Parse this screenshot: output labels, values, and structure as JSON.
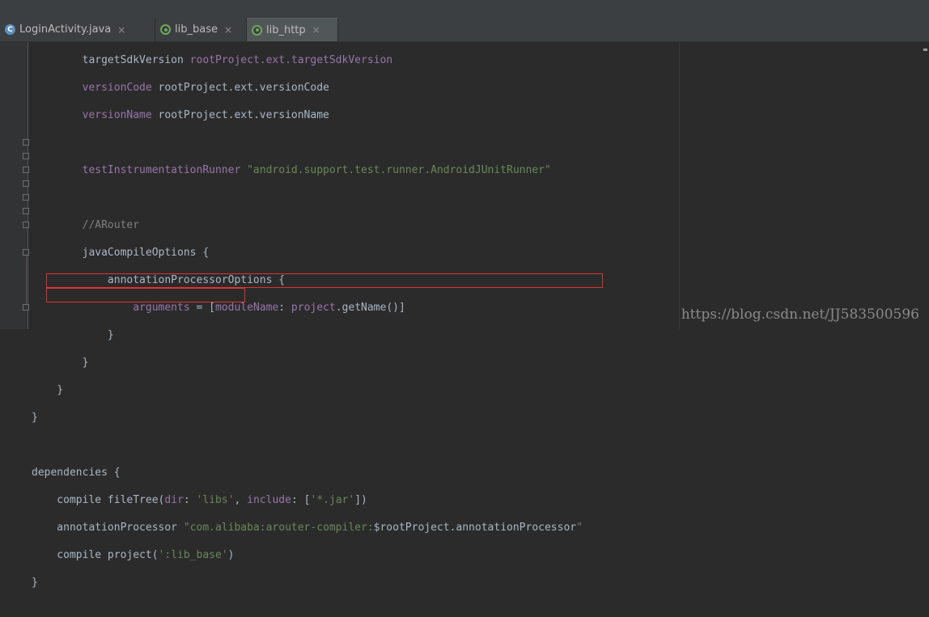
{
  "tabs": [
    {
      "label": "LoginActivity.java",
      "icon": "class-icon",
      "active": false
    },
    {
      "label": "lib_base",
      "icon": "module-icon",
      "active": false
    },
    {
      "label": "lib_http",
      "icon": "module-icon",
      "active": true
    }
  ],
  "close_glyph": "×",
  "code": {
    "l1a": "        targetSdkVersion ",
    "l1b": "rootProject.ext.targetSdkVersion",
    "l2a": "        versionCode ",
    "l2b": "rootProject.ext.versionCode",
    "l3a": "        versionName ",
    "l3b": "rootProject.ext.versionName",
    "l5a": "        testInstrumentationRunner ",
    "l5b": "\"android.support.test.runner.AndroidJUnitRunner\"",
    "l7": "        //ARouter",
    "l8": "        javaCompileOptions {",
    "l9": "            annotationProcessorOptions {",
    "l10a": "                arguments",
    "l10b": " = [",
    "l10c": "moduleName",
    "l10d": ": ",
    "l10e": "project",
    "l10f": ".getName()]",
    "l11": "            }",
    "l12": "        }",
    "l13": "    }",
    "l14": "}",
    "l16": "dependencies {",
    "l17a": "    compile fileTree(",
    "l17b": "dir",
    "l17c": ": ",
    "l17d": "'libs'",
    "l17e": ", ",
    "l17f": "include",
    "l17g": ": [",
    "l17h": "'*.jar'",
    "l17i": "])",
    "l18a": "    annotationProcessor ",
    "l18b": "\"com.alibaba:arouter-compiler:",
    "l18c": "$rootProject",
    "l18d": ".annotationProcessor",
    "l18e": "\"",
    "l19a": "    compile project(",
    "l19b": "':lib_base'",
    "l19c": ")",
    "l20": "}"
  },
  "watermark": "https://blog.csdn.net/JJ583500596"
}
